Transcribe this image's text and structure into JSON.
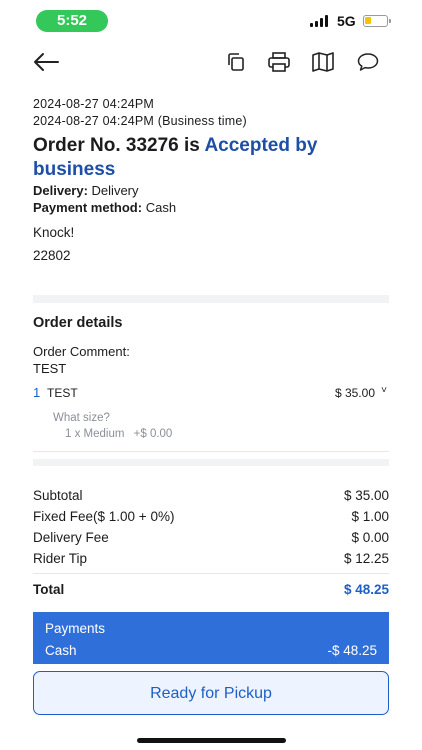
{
  "status_bar": {
    "time": "5:52",
    "network": "5G",
    "battery_level": 0.3,
    "battery_color": "#f5c400",
    "time_pill_color": "#34c759"
  },
  "toolbar": {
    "icons": [
      "back-arrow-icon",
      "copy-icon",
      "print-icon",
      "map-icon",
      "chat-bubble-icon"
    ]
  },
  "order": {
    "timestamp": "2024-08-27 04:24PM",
    "business_timestamp": "2024-08-27 04:24PM  (Business time)",
    "title_prefix": "Order No. 33276 is",
    "status": "Accepted by business",
    "delivery_label": "Delivery:",
    "delivery_value": "Delivery",
    "payment_label": "Payment method:",
    "payment_value": "Cash",
    "note_line1": "Knock!",
    "note_line2": "22802"
  },
  "details": {
    "section_title": "Order details",
    "comment_label": "Order Comment:",
    "comment_value": "TEST",
    "items": [
      {
        "qty": "1",
        "name": "TEST",
        "price": "$ 35.00",
        "chevron": "˅",
        "option_label": "What size?",
        "option_value": "1 x Medium",
        "option_price": "+$ 0.00"
      }
    ]
  },
  "summary": {
    "subtotal_label": "Subtotal",
    "subtotal_value": "$ 35.00",
    "fixed_fee_label": "Fixed Fee($ 1.00 + 0%)",
    "fixed_fee_value": "$ 1.00",
    "delivery_fee_label": "Delivery Fee",
    "delivery_fee_value": "$ 0.00",
    "rider_tip_label": "Rider Tip",
    "rider_tip_value": "$ 12.25",
    "total_label": "Total",
    "total_value": "$ 48.25"
  },
  "payments": {
    "title": "Payments",
    "method": "Cash",
    "amount": "-$ 48.25"
  },
  "actions": {
    "ready_label": "Ready for Pickup"
  },
  "colors": {
    "accent": "#1e5fc7",
    "status_text": "#1e4fa6",
    "payments_bg": "#2f6fd9"
  }
}
